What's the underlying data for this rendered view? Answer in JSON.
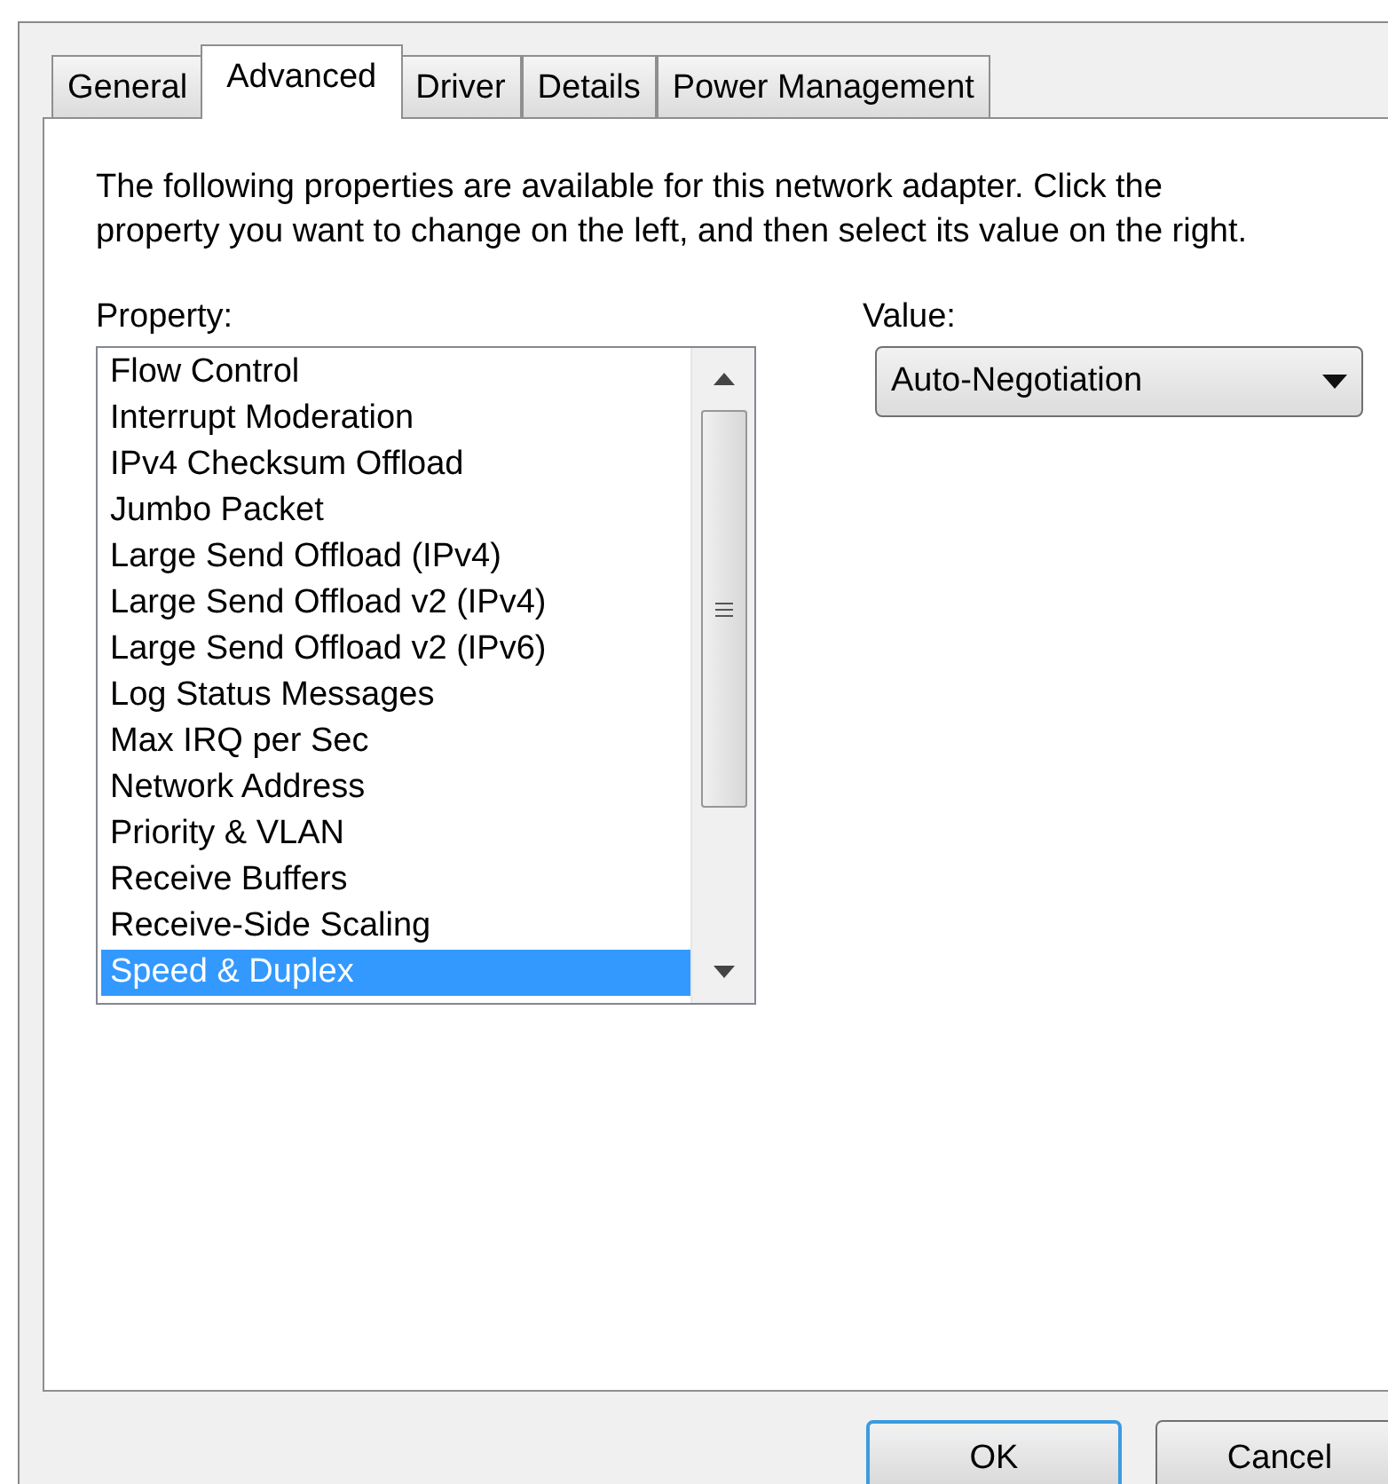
{
  "tabs": [
    {
      "label": "General",
      "selected": false
    },
    {
      "label": "Advanced",
      "selected": true
    },
    {
      "label": "Driver",
      "selected": false
    },
    {
      "label": "Details",
      "selected": false
    },
    {
      "label": "Power Management",
      "selected": false
    }
  ],
  "description": "The following properties are available for this network adapter. Click the property you want to change on the left, and then select its value on the right.",
  "property_label": "Property:",
  "properties": [
    {
      "label": "Flow Control",
      "selected": false
    },
    {
      "label": "Interrupt Moderation",
      "selected": false
    },
    {
      "label": "IPv4 Checksum Offload",
      "selected": false
    },
    {
      "label": "Jumbo Packet",
      "selected": false
    },
    {
      "label": "Large Send Offload (IPv4)",
      "selected": false
    },
    {
      "label": "Large Send Offload v2 (IPv4)",
      "selected": false
    },
    {
      "label": "Large Send Offload v2 (IPv6)",
      "selected": false
    },
    {
      "label": "Log Status Messages",
      "selected": false
    },
    {
      "label": "Max IRQ per Sec",
      "selected": false
    },
    {
      "label": "Network Address",
      "selected": false
    },
    {
      "label": "Priority & VLAN",
      "selected": false
    },
    {
      "label": "Receive Buffers",
      "selected": false
    },
    {
      "label": "Receive-Side Scaling",
      "selected": false
    },
    {
      "label": "Speed & Duplex",
      "selected": true
    }
  ],
  "value_label": "Value:",
  "value": "Auto-Negotiation",
  "buttons": [
    {
      "label": "OK",
      "default": true
    },
    {
      "label": "Cancel",
      "default": false
    }
  ]
}
